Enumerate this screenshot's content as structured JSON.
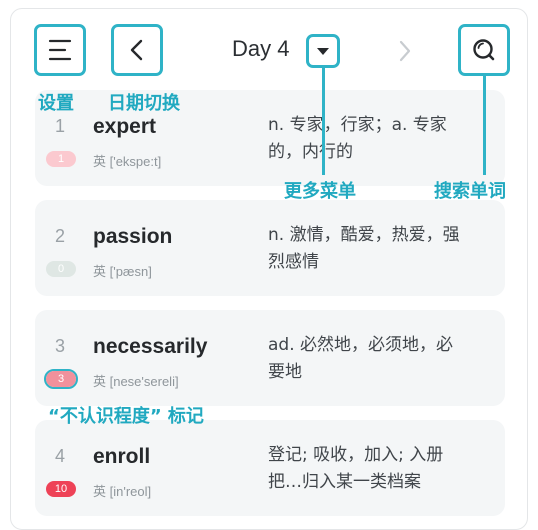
{
  "header": {
    "title": "Day 4",
    "menu_icon": "hamburger-menu-icon",
    "back_icon": "chevron-left-icon",
    "dropdown_icon": "caret-down-icon",
    "next_icon": "chevron-right-icon",
    "search_icon": "search-icon"
  },
  "annotations": {
    "settings": "设置",
    "date_switch": "日期切换",
    "more_menu": "更多菜单",
    "search_word": "搜索单词",
    "unfamiliarity_mark": "“不认识程度” 标记"
  },
  "words": [
    {
      "index": "1",
      "word": "expert",
      "badge": "1",
      "badge_color": "#fbc9cf",
      "phonetic": "英 ['ekspe:t]",
      "def_line1": "n. 专家，行家；a. 专家",
      "def_line2": "的，内行的"
    },
    {
      "index": "2",
      "word": "passion",
      "badge": "0",
      "badge_color": "#dfe7e4",
      "phonetic": "英 ['pæsn]",
      "def_line1": "n. 激情，酷爱，热爱，强",
      "def_line2": "烈感情"
    },
    {
      "index": "3",
      "word": "necessarily",
      "badge": "3",
      "badge_color": "#f1919c",
      "phonetic": "英 [nese'sereli]",
      "def_line1": "ad. 必然地，必须地，必",
      "def_line2": "要地"
    },
    {
      "index": "4",
      "word": "enroll",
      "badge": "10",
      "badge_color": "#ee4257",
      "phonetic": "英 [in'reol]",
      "def_line1": "登记; 吸收，加入; 入册",
      "def_line2": "把…归入某一类档案"
    }
  ],
  "colors": {
    "accent": "#2fb3c7",
    "annotation_text": "#21a9c0"
  }
}
